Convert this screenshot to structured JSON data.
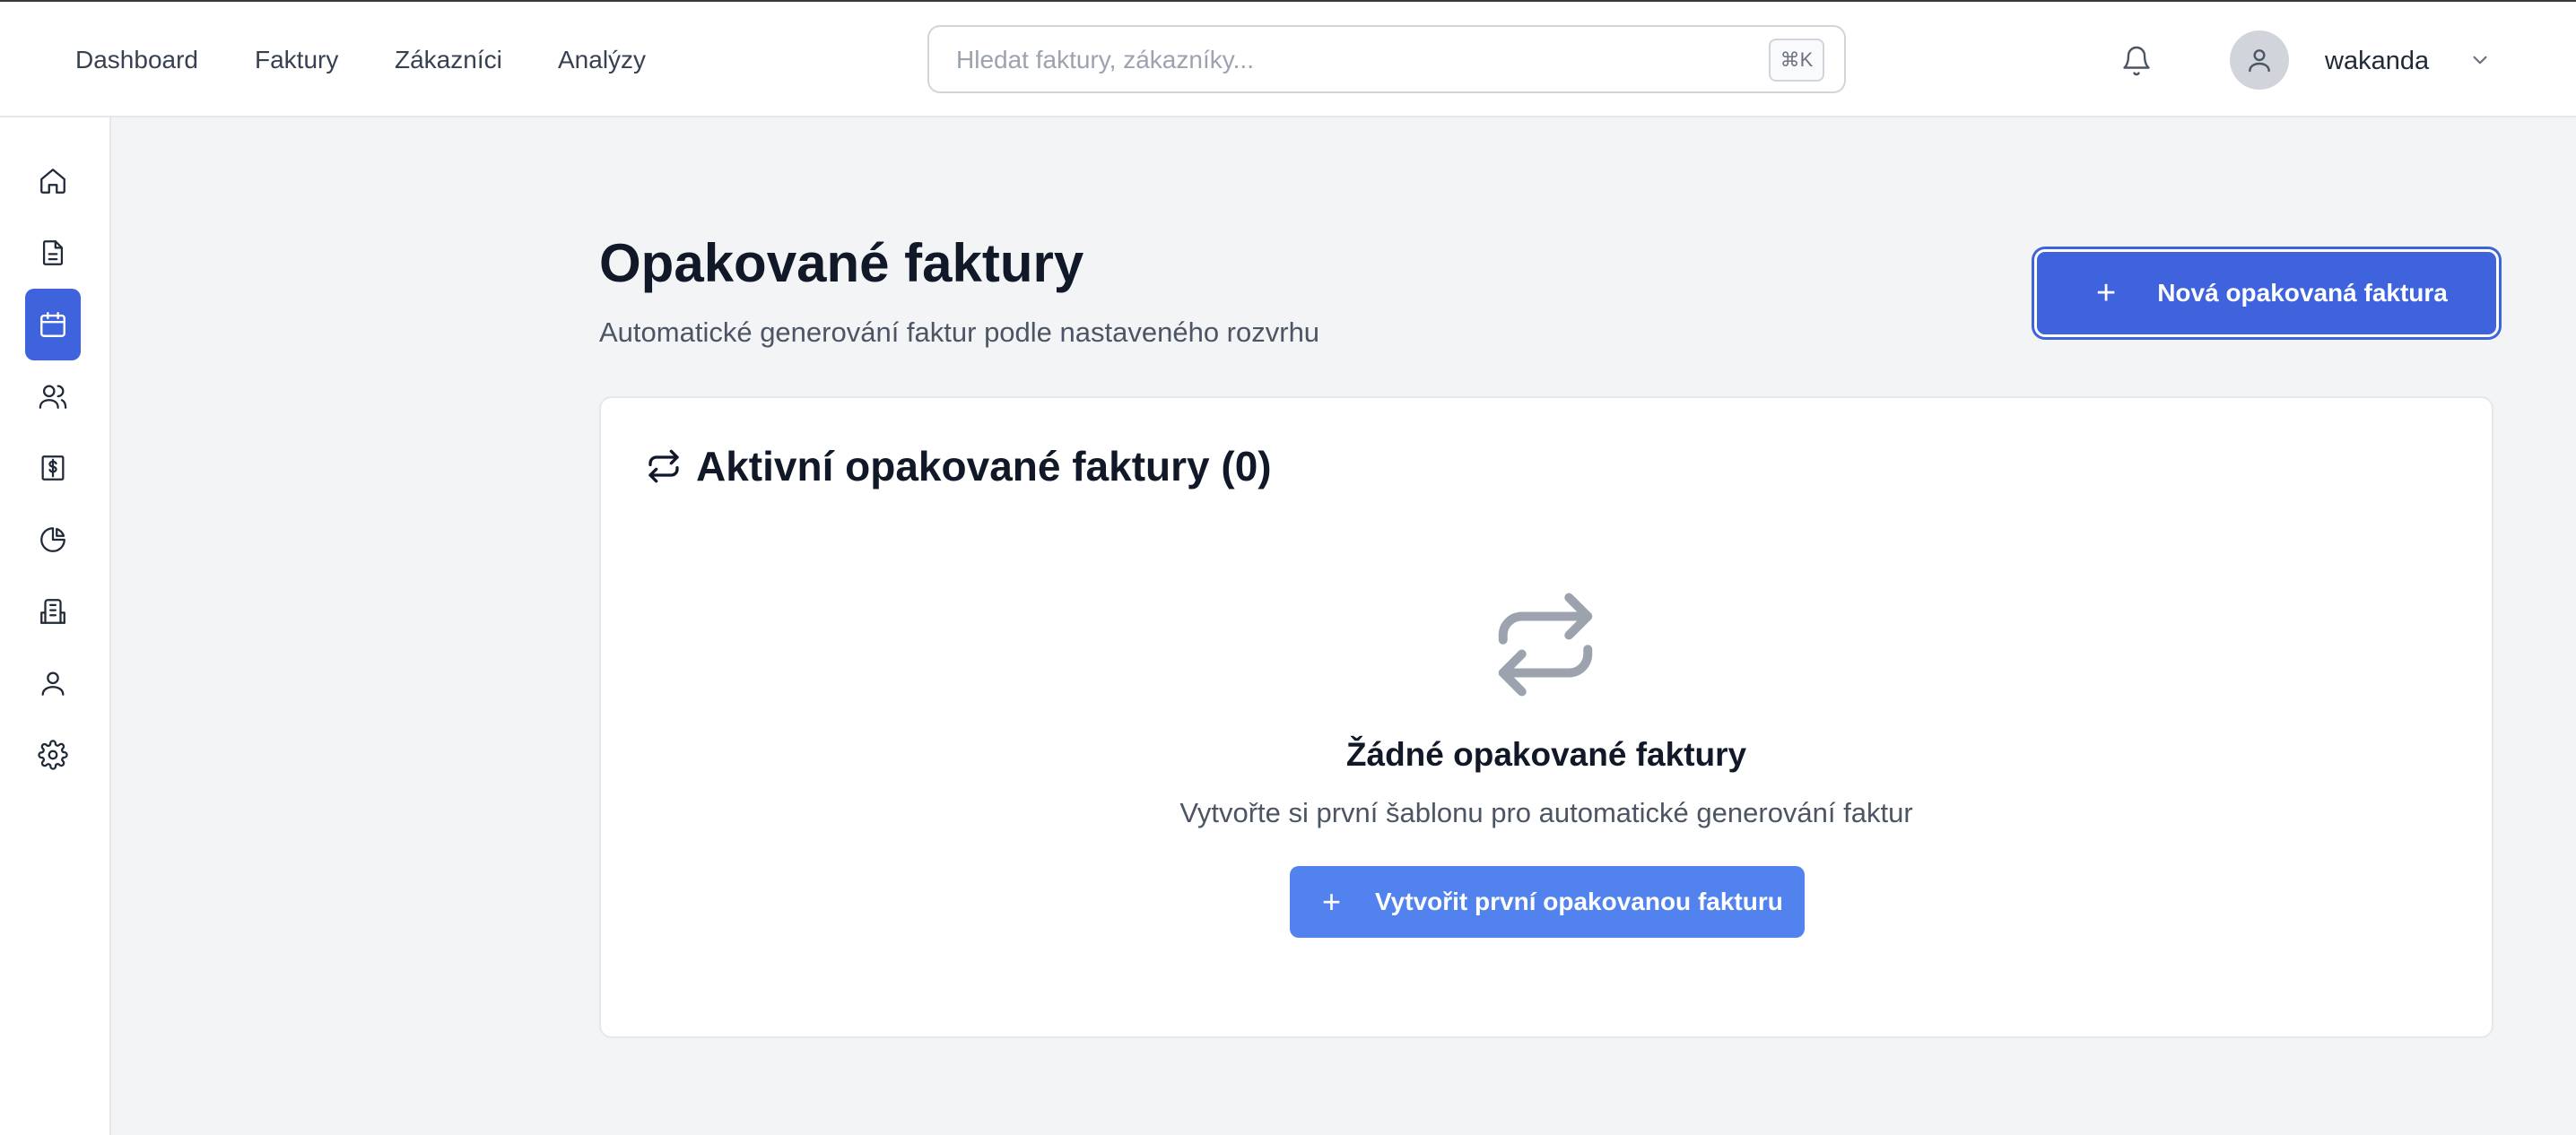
{
  "nav": {
    "links": [
      "Dashboard",
      "Faktury",
      "Zákazníci",
      "Analýzy"
    ]
  },
  "search": {
    "placeholder": "Hledat faktury, zákazníky...",
    "shortcut": "⌘K"
  },
  "user": {
    "name": "wakanda"
  },
  "sidebar": {
    "items": [
      {
        "icon": "home-icon",
        "active": false
      },
      {
        "icon": "document-icon",
        "active": false
      },
      {
        "icon": "calendar-icon",
        "active": true
      },
      {
        "icon": "users-icon",
        "active": false
      },
      {
        "icon": "dollar-receipt-icon",
        "active": false
      },
      {
        "icon": "pie-chart-icon",
        "active": false
      },
      {
        "icon": "building-icon",
        "active": false
      },
      {
        "icon": "user-icon",
        "active": false
      },
      {
        "icon": "gear-icon",
        "active": false
      }
    ]
  },
  "page": {
    "title": "Opakované faktury",
    "subtitle": "Automatické generování faktur podle nastaveného rozvrhu",
    "new_button_label": "Nová opakovaná faktura"
  },
  "card": {
    "title": "Aktivní opakované faktury (0)",
    "empty_title": "Žádné opakované faktury",
    "empty_desc": "Vytvořte si první šablonu pro automatické generování faktur",
    "create_button_label": "Vytvořit první opakovanou fakturu"
  },
  "colors": {
    "accent": "#3e63dd",
    "accent_light": "#5182ee",
    "background": "#f3f4f6"
  }
}
